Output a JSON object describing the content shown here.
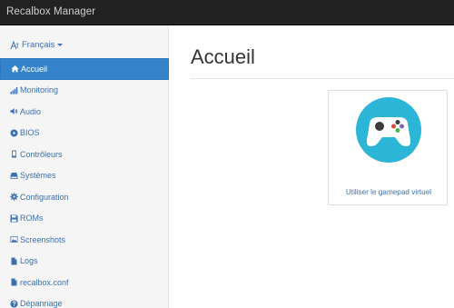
{
  "app": {
    "title": "Recalbox Manager"
  },
  "language": {
    "label": "Français"
  },
  "sidebar": {
    "items": [
      {
        "label": "Accueil",
        "icon": "home-icon",
        "active": true
      },
      {
        "label": "Monitoring",
        "icon": "signal-bars-icon"
      },
      {
        "label": "Audio",
        "icon": "volume-icon"
      },
      {
        "label": "BIOS",
        "icon": "disc-icon"
      },
      {
        "label": "Contrôleurs",
        "icon": "phone-icon"
      },
      {
        "label": "Systèmes",
        "icon": "hdd-icon"
      },
      {
        "label": "Configuration",
        "icon": "gear-icon"
      },
      {
        "label": "ROMs",
        "icon": "floppy-icon"
      },
      {
        "label": "Screenshots",
        "icon": "picture-icon"
      },
      {
        "label": "Logs",
        "icon": "file-icon"
      },
      {
        "label": "recalbox.conf",
        "icon": "file-icon"
      },
      {
        "label": "Dépannage",
        "icon": "question-circle-icon"
      }
    ]
  },
  "main": {
    "title": "Accueil",
    "card": {
      "link_label": "Utiliser le gamepad virtuel",
      "icon": "gamepad-icon"
    }
  },
  "colors": {
    "topbar": "#222222",
    "sidebar": "#f5f5f5",
    "accent": "#3584cb",
    "link": "#3a70b0",
    "gamepad_circle": "#2bb5d6"
  }
}
